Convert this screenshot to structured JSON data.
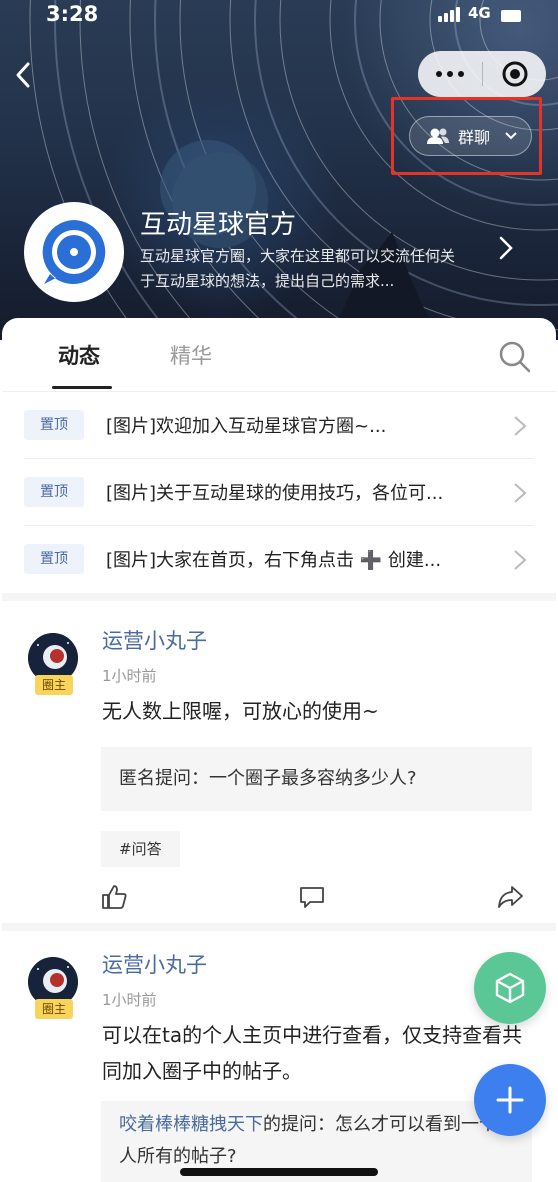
{
  "status_bar": {
    "time": "3:28",
    "network": "4G"
  },
  "header": {
    "group_chat_label": "群聊",
    "circle_name": "互动星球官方",
    "circle_description": "互动星球官方圈，大家在这里都可以交流任何关于互动星球的想法，提出自己的需求..."
  },
  "tabs": [
    {
      "label": "动态",
      "active": true
    },
    {
      "label": "精华",
      "active": false
    }
  ],
  "pinned": [
    {
      "badge": "置顶",
      "text": "[图片]欢迎加入互动星球官方圈~..."
    },
    {
      "badge": "置顶",
      "text": "[图片]关于互动星球的使用技巧，各位可..."
    },
    {
      "badge": "置顶",
      "text": "[图片]大家在首页，右下角点击 ➕ 创建..."
    }
  ],
  "posts": [
    {
      "author": "运营小丸子",
      "role_badge": "圈主",
      "time": "1小时前",
      "body": "无人数上限喔，可放心的使用~",
      "quote": "匿名提问：一个圈子最多容纳多少人?",
      "tag": "#问答"
    },
    {
      "author": "运营小丸子",
      "role_badge": "圈主",
      "time": "1小时前",
      "body": "可以在ta的个人主页中进行查看，仅支持查看共同加入圈子中的帖子。",
      "quote_user": "咬着棒棒糖拽天下",
      "quote_rest": "的提问：怎么才可以看到一个人所有的帖子?"
    }
  ],
  "colors": {
    "accent_blue": "#3e7ff0",
    "fab_green": "#5bc796",
    "link_blue": "#4a6aa0",
    "highlight_red": "#e53326",
    "owner_badge": "#f9d45c"
  },
  "icons": [
    "back-icon",
    "more-icon",
    "target-icon",
    "group-icon",
    "chevron-down-icon",
    "chevron-right-icon",
    "search-icon",
    "like-icon",
    "comment-icon",
    "share-icon",
    "cube-icon",
    "plus-icon"
  ]
}
